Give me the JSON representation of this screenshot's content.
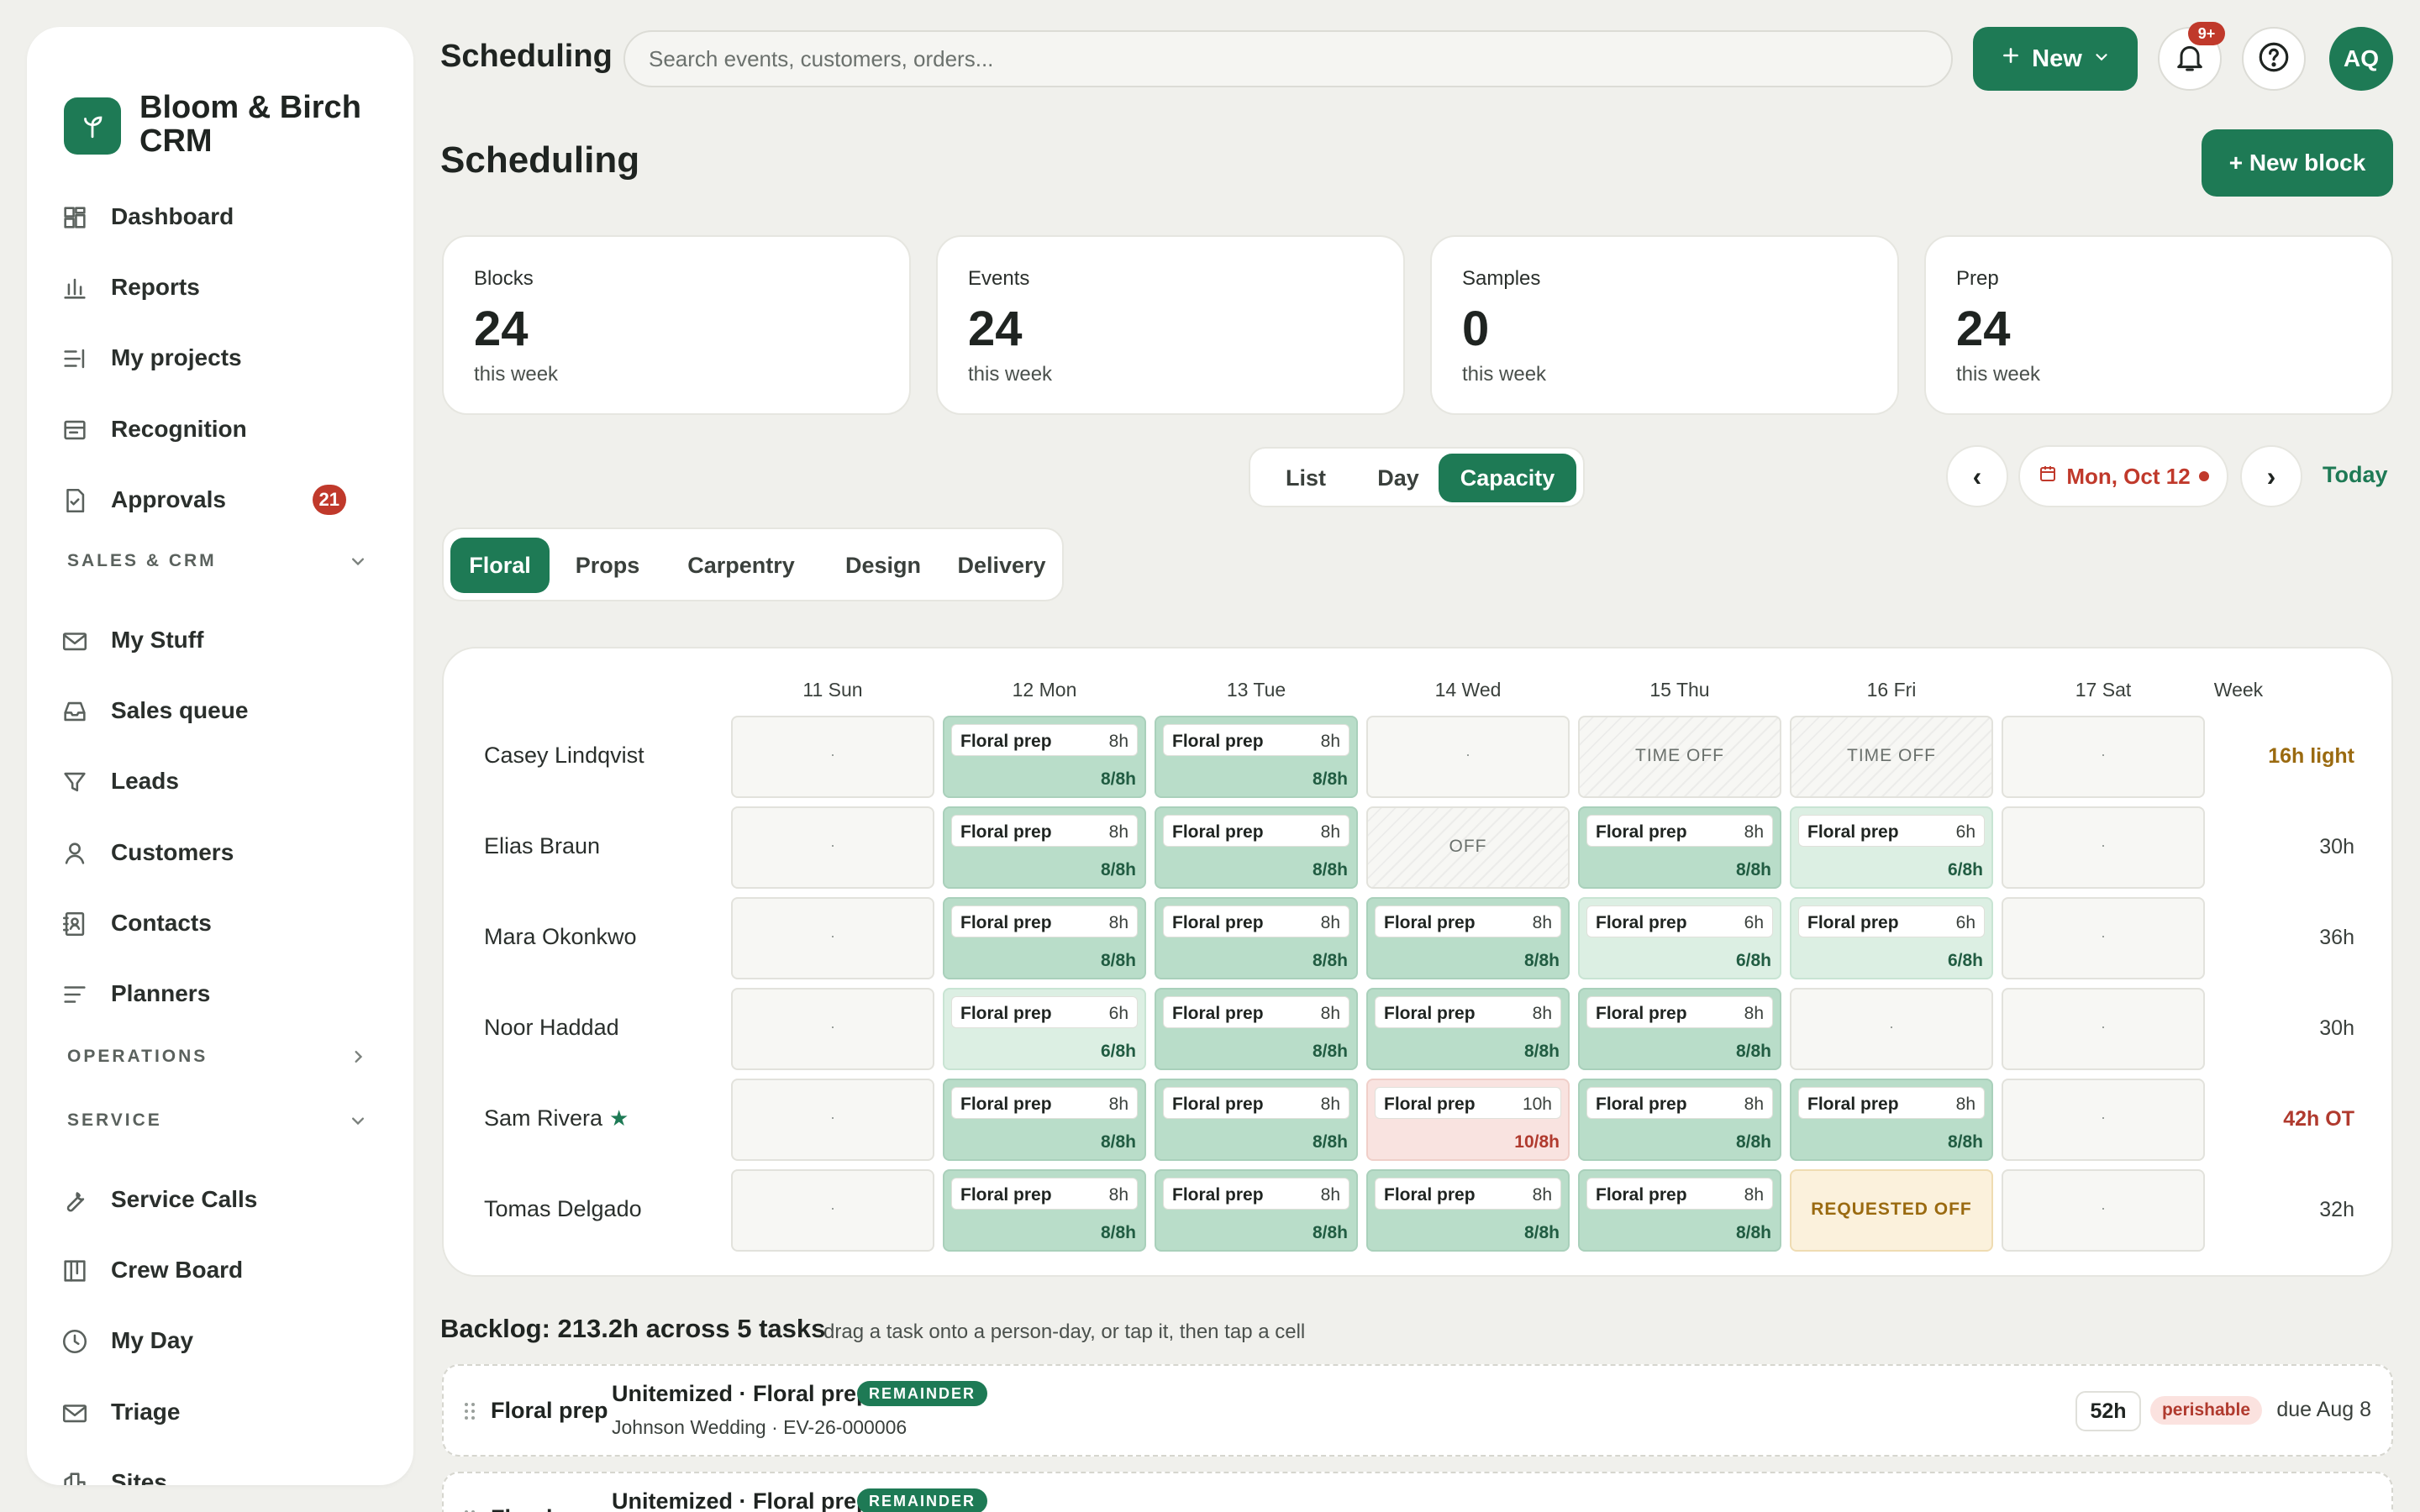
{
  "app": {
    "name": "Bloom & Birch CRM",
    "top_title": "Scheduling"
  },
  "search": {
    "placeholder": "Search events, customers, orders..."
  },
  "header": {
    "new_label": "New",
    "notifications_badge": "9+",
    "avatar_initials": "AQ"
  },
  "sidebar": {
    "items": [
      {
        "label": "Dashboard",
        "icon": "dashboard-icon"
      },
      {
        "label": "Reports",
        "icon": "bar-chart-icon"
      },
      {
        "label": "My projects",
        "icon": "list-icon"
      },
      {
        "label": "Recognition",
        "icon": "card-icon"
      },
      {
        "label": "Approvals",
        "icon": "document-check-icon",
        "badge": "21"
      }
    ],
    "sections": [
      {
        "label": "SALES & CRM",
        "expanded": true
      },
      {
        "label": "OPERATIONS",
        "expanded": false
      },
      {
        "label": "SERVICE",
        "expanded": true
      }
    ],
    "sales_items": [
      {
        "label": "My Stuff",
        "icon": "mail-icon"
      },
      {
        "label": "Sales queue",
        "icon": "inbox-icon"
      },
      {
        "label": "Leads",
        "icon": "filter-icon"
      },
      {
        "label": "Customers",
        "icon": "person-icon"
      },
      {
        "label": "Contacts",
        "icon": "contact-book-icon"
      },
      {
        "label": "Planners",
        "icon": "lines-icon"
      }
    ],
    "service_items": [
      {
        "label": "Service Calls",
        "icon": "wrench-icon"
      },
      {
        "label": "Crew Board",
        "icon": "board-icon"
      },
      {
        "label": "My Day",
        "icon": "clock-icon"
      },
      {
        "label": "Triage",
        "icon": "mail-icon"
      },
      {
        "label": "Sites",
        "icon": "building-icon"
      }
    ]
  },
  "page": {
    "title": "Scheduling",
    "new_block_label": "+ New block"
  },
  "stats": [
    {
      "label": "Blocks",
      "value": "24",
      "sub": "this week"
    },
    {
      "label": "Events",
      "value": "24",
      "sub": "this week"
    },
    {
      "label": "Samples",
      "value": "0",
      "sub": "this week"
    },
    {
      "label": "Prep",
      "value": "24",
      "sub": "this week"
    }
  ],
  "view_toggle": {
    "options": [
      "List",
      "Day",
      "Capacity"
    ],
    "selected": "Capacity"
  },
  "date_nav": {
    "prev": "‹",
    "next": "›",
    "date": "Mon, Oct 12",
    "today": "Today"
  },
  "departments": {
    "options": [
      "Floral",
      "Props",
      "Carpentry",
      "Design",
      "Delivery"
    ],
    "selected": "Floral"
  },
  "grid": {
    "days": [
      "11 Sun",
      "12 Mon",
      "13 Tue",
      "14 Wed",
      "15 Thu",
      "16 Fri",
      "17 Sat"
    ],
    "week_label": "Week",
    "rows": [
      {
        "name": "Casey Lindqvist",
        "star": false,
        "week": "16h light",
        "week_color": "#9a6a10",
        "cells": [
          {
            "type": "empty",
            "text": "·"
          },
          {
            "type": "full",
            "task": "Floral prep",
            "hours": "8h",
            "cap": "8/8h"
          },
          {
            "type": "full",
            "task": "Floral prep",
            "hours": "8h",
            "cap": "8/8h"
          },
          {
            "type": "empty",
            "text": "·"
          },
          {
            "type": "hatch",
            "text": "TIME OFF"
          },
          {
            "type": "hatch",
            "text": "TIME OFF"
          },
          {
            "type": "empty",
            "text": "·"
          }
        ]
      },
      {
        "name": "Elias Braun",
        "star": false,
        "week": "30h",
        "week_color": "#3a403c",
        "cells": [
          {
            "type": "empty",
            "text": "·"
          },
          {
            "type": "full",
            "task": "Floral prep",
            "hours": "8h",
            "cap": "8/8h"
          },
          {
            "type": "full",
            "task": "Floral prep",
            "hours": "8h",
            "cap": "8/8h"
          },
          {
            "type": "hatch",
            "text": "OFF"
          },
          {
            "type": "full",
            "task": "Floral prep",
            "hours": "8h",
            "cap": "8/8h"
          },
          {
            "type": "part",
            "task": "Floral prep",
            "hours": "6h",
            "cap": "6/8h"
          },
          {
            "type": "empty",
            "text": "·"
          }
        ]
      },
      {
        "name": "Mara Okonkwo",
        "star": false,
        "week": "36h",
        "week_color": "#3a403c",
        "cells": [
          {
            "type": "empty",
            "text": "·"
          },
          {
            "type": "full",
            "task": "Floral prep",
            "hours": "8h",
            "cap": "8/8h"
          },
          {
            "type": "full",
            "task": "Floral prep",
            "hours": "8h",
            "cap": "8/8h"
          },
          {
            "type": "full",
            "task": "Floral prep",
            "hours": "8h",
            "cap": "8/8h"
          },
          {
            "type": "part",
            "task": "Floral prep",
            "hours": "6h",
            "cap": "6/8h"
          },
          {
            "type": "part",
            "task": "Floral prep",
            "hours": "6h",
            "cap": "6/8h"
          },
          {
            "type": "empty",
            "text": "·"
          }
        ]
      },
      {
        "name": "Noor Haddad",
        "star": false,
        "week": "30h",
        "week_color": "#3a403c",
        "cells": [
          {
            "type": "empty",
            "text": "·"
          },
          {
            "type": "part",
            "task": "Floral prep",
            "hours": "6h",
            "cap": "6/8h"
          },
          {
            "type": "full",
            "task": "Floral prep",
            "hours": "8h",
            "cap": "8/8h"
          },
          {
            "type": "full",
            "task": "Floral prep",
            "hours": "8h",
            "cap": "8/8h"
          },
          {
            "type": "full",
            "task": "Floral prep",
            "hours": "8h",
            "cap": "8/8h"
          },
          {
            "type": "empty",
            "text": "·"
          },
          {
            "type": "empty",
            "text": "·"
          }
        ]
      },
      {
        "name": "Sam Rivera",
        "star": true,
        "week": "42h OT",
        "week_color": "#b03a2e",
        "cells": [
          {
            "type": "empty",
            "text": "·"
          },
          {
            "type": "full",
            "task": "Floral prep",
            "hours": "8h",
            "cap": "8/8h"
          },
          {
            "type": "full",
            "task": "Floral prep",
            "hours": "8h",
            "cap": "8/8h"
          },
          {
            "type": "over",
            "task": "Floral prep",
            "hours": "10h",
            "cap": "10/8h"
          },
          {
            "type": "full",
            "task": "Floral prep",
            "hours": "8h",
            "cap": "8/8h"
          },
          {
            "type": "full",
            "task": "Floral prep",
            "hours": "8h",
            "cap": "8/8h"
          },
          {
            "type": "empty",
            "text": "·"
          }
        ]
      },
      {
        "name": "Tomas Delgado",
        "star": false,
        "week": "32h",
        "week_color": "#3a403c",
        "cells": [
          {
            "type": "empty",
            "text": "·"
          },
          {
            "type": "full",
            "task": "Floral prep",
            "hours": "8h",
            "cap": "8/8h"
          },
          {
            "type": "full",
            "task": "Floral prep",
            "hours": "8h",
            "cap": "8/8h"
          },
          {
            "type": "full",
            "task": "Floral prep",
            "hours": "8h",
            "cap": "8/8h"
          },
          {
            "type": "full",
            "task": "Floral prep",
            "hours": "8h",
            "cap": "8/8h"
          },
          {
            "type": "req",
            "text": "REQUESTED OFF"
          },
          {
            "type": "empty",
            "text": "·"
          }
        ]
      }
    ]
  },
  "backlog": {
    "title": "Backlog: 213.2h across 5 tasks",
    "hint": "drag a task onto a person-day, or tap it, then tap a cell",
    "items": [
      {
        "label": "Floral prep",
        "title": "Unitemized · Floral prep",
        "tag": "REMAINDER",
        "sub": "Johnson Wedding · EV-26-000006",
        "hours": "52h",
        "flag": "perishable",
        "due": "due Aug 8"
      },
      {
        "label": "Floral prep",
        "title": "Unitemized · Floral prep",
        "tag": "REMAINDER",
        "sub": "",
        "hours": "",
        "flag": "",
        "due": ""
      }
    ]
  },
  "colors": {
    "brand": "#1e7a55",
    "alert": "#c0392b"
  }
}
